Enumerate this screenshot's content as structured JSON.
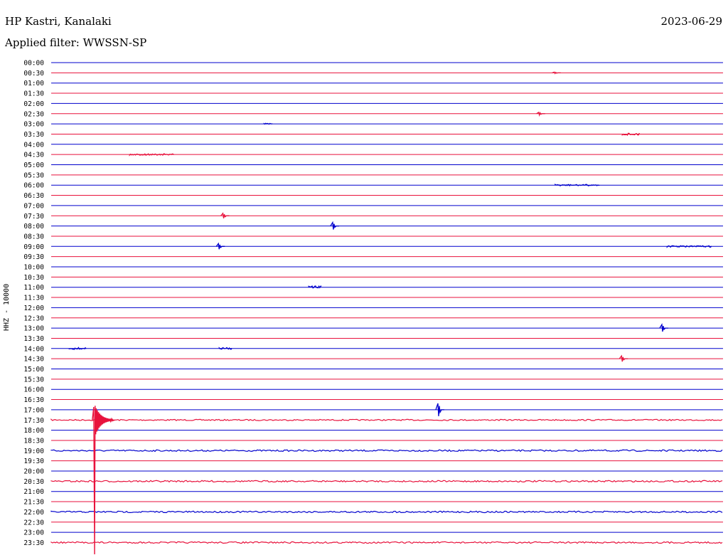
{
  "header": {
    "station": "HP Kastri, Kanalaki",
    "filter": "Applied filter: WWSSN-SP",
    "date": "2023-06-29"
  },
  "chart_data": {
    "type": "line",
    "title": "HP Kastri, Kanalaki",
    "subtitle": "Applied filter: WWSSN-SP",
    "ylabel": "HHZ - 10000",
    "date": "2023-06-29",
    "colors": {
      "even_rows": "#0000cd",
      "odd_rows": "#e8123c"
    },
    "row_labels": [
      "00:00",
      "00:30",
      "01:00",
      "01:30",
      "02:00",
      "02:30",
      "03:00",
      "03:30",
      "04:00",
      "04:30",
      "05:00",
      "05:30",
      "06:00",
      "06:30",
      "07:00",
      "07:30",
      "08:00",
      "08:30",
      "09:00",
      "09:30",
      "10:00",
      "10:30",
      "11:00",
      "11:30",
      "12:00",
      "12:30",
      "13:00",
      "13:30",
      "14:00",
      "14:30",
      "15:00",
      "15:30",
      "16:00",
      "16:30",
      "17:00",
      "17:30",
      "18:00",
      "18:30",
      "19:00",
      "19:30",
      "20:00",
      "20:30",
      "21:00",
      "21:30",
      "22:00",
      "22:30",
      "23:00",
      "23:30"
    ],
    "row_minutes": 30,
    "noise_rows": [
      {
        "label": "17:30",
        "level": 0.8
      },
      {
        "label": "19:00",
        "level": 1.0
      },
      {
        "label": "20:30",
        "level": 1.0
      },
      {
        "label": "22:00",
        "level": 1.0
      },
      {
        "label": "23:30",
        "level": 1.0
      }
    ],
    "events": [
      {
        "label": "00:30",
        "minute": 22.5,
        "amplitude": 1
      },
      {
        "label": "02:30",
        "minute": 21.8,
        "amplitude": 2
      },
      {
        "label": "03:00",
        "minute": 9.5,
        "amplitude": 1,
        "duration": 0.4
      },
      {
        "label": "03:30",
        "minute": 25.5,
        "amplitude": 1.5,
        "duration": 0.8
      },
      {
        "label": "04:30",
        "minute": 3.5,
        "amplitude": 1,
        "duration": 2
      },
      {
        "label": "06:00",
        "minute": 22.5,
        "amplitude": 1,
        "duration": 2
      },
      {
        "label": "07:30",
        "minute": 7.7,
        "amplitude": 3.5
      },
      {
        "label": "08:00",
        "minute": 12.6,
        "amplitude": 5
      },
      {
        "label": "09:00",
        "minute": 7.5,
        "amplitude": 4
      },
      {
        "label": "09:00",
        "minute": 27.5,
        "amplitude": 1,
        "duration": 2
      },
      {
        "label": "11:00",
        "minute": 11.5,
        "amplitude": 2,
        "duration": 0.6
      },
      {
        "label": "13:00",
        "minute": 27.3,
        "amplitude": 5
      },
      {
        "label": "14:00",
        "minute": 0.8,
        "amplitude": 1.5,
        "duration": 0.8
      },
      {
        "label": "14:00",
        "minute": 7.5,
        "amplitude": 1.5,
        "duration": 0.6
      },
      {
        "label": "14:30",
        "minute": 25.5,
        "amplitude": 4
      },
      {
        "label": "17:00",
        "minute": 17.3,
        "amplitude": 9
      },
      {
        "label": "17:30",
        "minute": 1.9,
        "amplitude": 190
      }
    ]
  }
}
